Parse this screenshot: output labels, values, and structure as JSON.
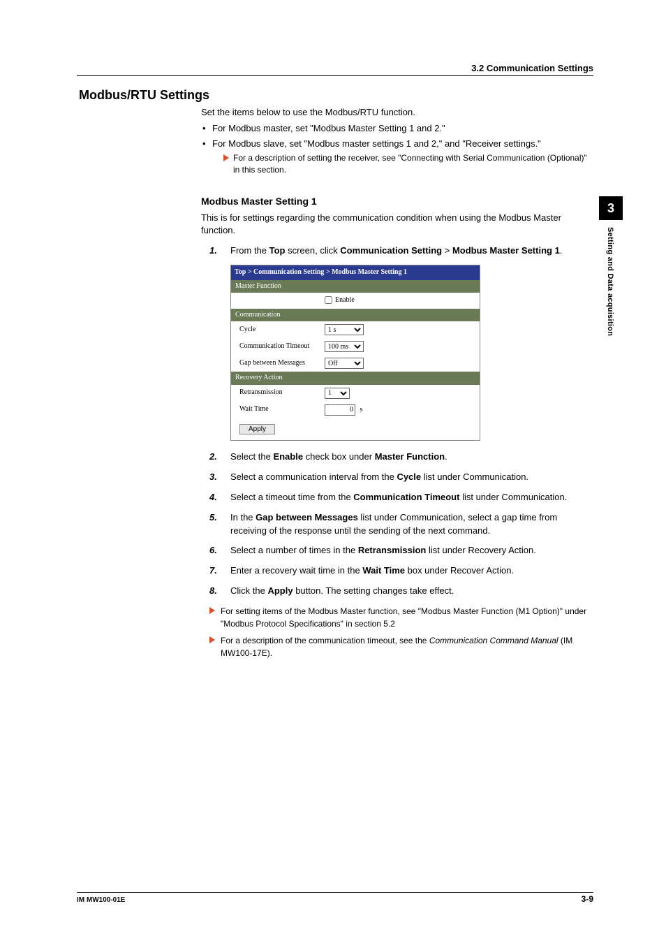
{
  "header": {
    "section": "3.2  Communication Settings"
  },
  "title": "Modbus/RTU Settings",
  "intro": "Set the items below to use the Modbus/RTU function.",
  "bullets": [
    "For Modbus master, set \"Modbus Master Setting 1 and 2.\"",
    "For Modbus slave, set \"Modbus master settings 1 and 2,\" and \"Receiver settings.\""
  ],
  "arrow1": "For a description of setting the receiver, see \"Connecting with Serial Communication (Optional)\" in this section.",
  "sub": {
    "heading": "Modbus Master Setting 1",
    "desc": "This is for settings regarding the communication condition when using the Modbus Master function."
  },
  "step1": {
    "num": "1.",
    "pre": "From the ",
    "b1": "Top",
    "mid1": " screen, click ",
    "b2": "Communication Setting",
    "mid2": " > ",
    "b3": "Modbus Master Setting 1",
    "post": "."
  },
  "fig": {
    "breadcrumb": "Top > Communication Setting > Modbus Master Setting 1",
    "sections": {
      "master": "Master Function",
      "comm": "Communication",
      "recovery": "Recovery Action"
    },
    "rows": {
      "enable": {
        "label": "",
        "checkboxText": "Enable"
      },
      "cycle": {
        "label": "Cycle",
        "value": "1 s"
      },
      "timeout": {
        "label": "Communication Timeout",
        "value": "100 ms"
      },
      "gap": {
        "label": "Gap between Messages",
        "value": "Off"
      },
      "retrans": {
        "label": "Retransmission",
        "value": "1"
      },
      "wait": {
        "label": "Wait Time",
        "value": "0",
        "unit": "s"
      }
    },
    "apply": "Apply"
  },
  "steps": [
    {
      "num": "2.",
      "parts": [
        "Select the ",
        "Enable",
        " check box under ",
        "Master Function",
        "."
      ]
    },
    {
      "num": "3.",
      "parts": [
        "Select a communication interval from the ",
        "Cycle",
        " list under Communication."
      ]
    },
    {
      "num": "4.",
      "parts": [
        "Select a timeout time from the ",
        "Communication Timeout",
        " list under Communication."
      ]
    },
    {
      "num": "5.",
      "parts": [
        "In the ",
        "Gap between Messages",
        " list under Communication, select a gap time from receiving of the response until the sending of the next command."
      ]
    },
    {
      "num": "6.",
      "parts": [
        "Select a number of times in the ",
        "Retransmission",
        " list under Recovery Action."
      ]
    },
    {
      "num": "7.",
      "parts": [
        "Enter a recovery wait time in the ",
        "Wait Time",
        " box under Recover Action."
      ]
    },
    {
      "num": "8.",
      "parts": [
        "Click the ",
        "Apply",
        " button. The setting changes take effect."
      ]
    }
  ],
  "arrow2": "For setting items of the Modbus Master function, see \"Modbus Master Function (M1 Option)\" under \"Modbus Protocol Specifications\" in section 5.2",
  "arrow3": {
    "pre": "For a description of the communication timeout, see the ",
    "ital": "Communication Command Manual",
    "post": " (IM MW100-17E)."
  },
  "sidetab": {
    "chapter": "3",
    "title": "Setting and Data acquisition"
  },
  "footer": {
    "left": "IM MW100-01E",
    "right": "3-9"
  }
}
